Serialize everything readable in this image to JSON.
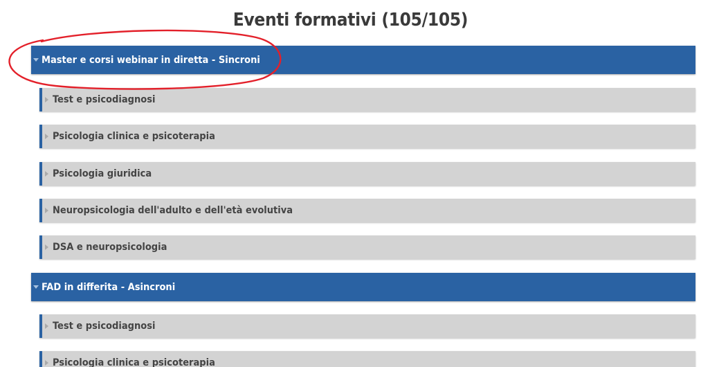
{
  "page_title": "Eventi formativi (105/105)",
  "sections": [
    {
      "label": "Master e corsi webinar in diretta - Sincroni",
      "items": [
        "Test e psicodiagnosi",
        "Psicologia clinica e psicoterapia",
        "Psicologia giuridica",
        "Neuropsicologia dell'adulto e dell'età evolutiva",
        "DSA e neuropsicologia"
      ]
    },
    {
      "label": "FAD in differita - Asincroni",
      "items": [
        "Test e psicodiagnosi",
        "Psicologia clinica e psicoterapia"
      ]
    }
  ],
  "colors": {
    "header_bg": "#2a62a3",
    "item_bg": "#d3d3d3",
    "annotation": "#e3202a"
  }
}
